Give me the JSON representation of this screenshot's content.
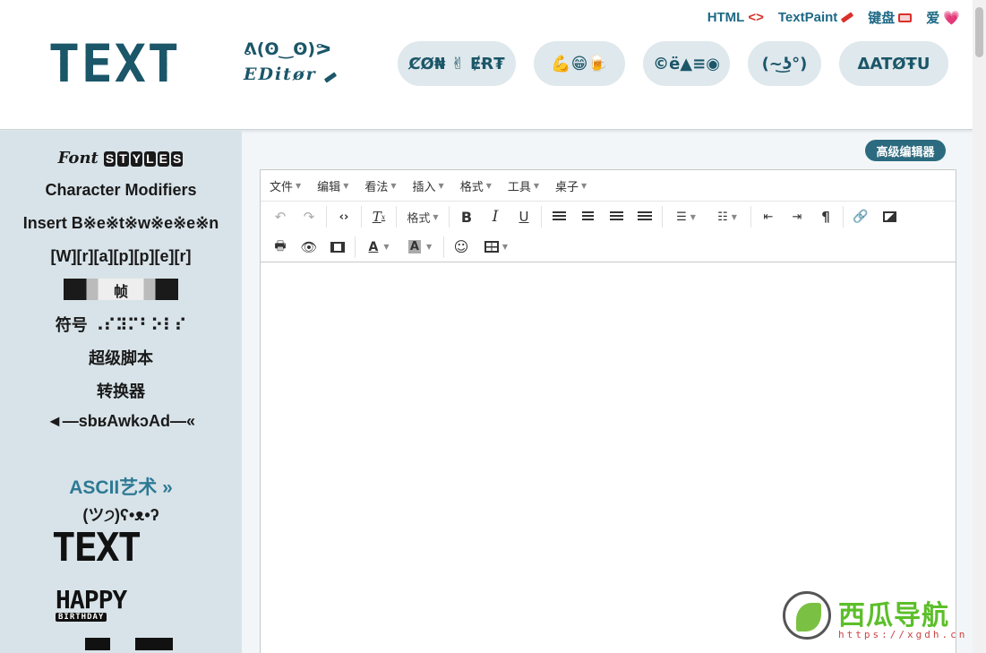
{
  "toplinks": {
    "html": "HTML",
    "html_icon": "<>",
    "textpaint": "TextPaint",
    "keyboard": "键盘",
    "love": "爱",
    "love_icon": "💗"
  },
  "logo": {
    "big": "TEXT",
    "face": "ᕕ(ʘ‿ʘ)ᕗ",
    "editor": "EDitør"
  },
  "pills": [
    {
      "label": "ȻØ₦ ✌ ɆɌ₮",
      "name": "convert-pill"
    },
    {
      "label": "💪😁🍺",
      "name": "emoji-pill"
    },
    {
      "label": "©ë▲≡◉",
      "name": "symbols-pill"
    },
    {
      "label": "(~͜ʖ°)",
      "name": "lenny-pill"
    },
    {
      "label": "ΔATØŦU",
      "name": "fancy-pill"
    }
  ],
  "sidebar": {
    "font_styles_prefix": "Font",
    "font_styles_badges": [
      "S",
      "T",
      "Y",
      "L",
      "E",
      "S"
    ],
    "character_modifiers": "Character Modifiers",
    "insert_between": "Insert B※e※t※w※e※e※n",
    "wrapper": "[W][r][a][p][p][e][r]",
    "frame": "帧",
    "symbols": "符号 ⠠⠎⠽⠍⠃⠕⠇⠎",
    "superscript": "超级脚本",
    "converter": "转换器",
    "backwards": "◄—sbʁAwkɔAd—«",
    "ascii_art": "ASCII艺术 »",
    "ascii_faces": "(ツ੭)ʕ•ᴥ•ʔ",
    "art_text": "TEXT",
    "art_happy": "HAPPY",
    "art_birthday": "BIRTHDAY"
  },
  "advanced_editor": "高级编辑器",
  "editor": {
    "menus": [
      "文件",
      "编辑",
      "看法",
      "插入",
      "格式",
      "工具",
      "桌子"
    ],
    "format_label": "格式"
  },
  "watermark": {
    "title": "西瓜导航",
    "url": "https://xgdh.cn"
  },
  "colors": {
    "brand": "#1b5669",
    "accent_red": "#d9302b",
    "sidebar_bg": "#d8e3e9",
    "pill_bg": "#dfe8ec",
    "button_dark": "#2c6b7f"
  }
}
